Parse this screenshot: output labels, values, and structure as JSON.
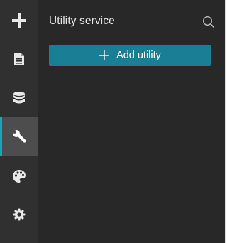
{
  "sidebar": {
    "items": [
      {
        "name": "add",
        "icon": "plus-icon",
        "active": false
      },
      {
        "name": "content",
        "icon": "document-icon",
        "active": false
      },
      {
        "name": "data",
        "icon": "database-icon",
        "active": false
      },
      {
        "name": "utility",
        "icon": "wrench-icon",
        "active": true
      },
      {
        "name": "theme",
        "icon": "palette-icon",
        "active": false
      },
      {
        "name": "settings",
        "icon": "gear-icon",
        "active": false
      }
    ],
    "accent_color": "#1ba5b8"
  },
  "panel": {
    "title": "Utility service",
    "search_icon": "search-icon",
    "add_button_label": "Add utility",
    "add_button_color": "#1a7f94"
  }
}
